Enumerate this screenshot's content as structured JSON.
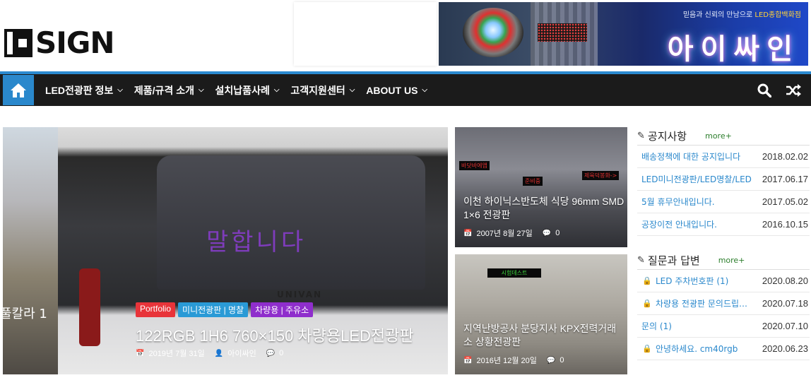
{
  "header": {
    "logo_text": "SIGN",
    "banner": {
      "subtitle_pre": "믿음과 신뢰의 만남으로 ",
      "subtitle_hl": "LED종합백화점",
      "title": "아이싸인",
      "led_sign_text": "LED"
    }
  },
  "nav": {
    "items": [
      {
        "label": "LED전광판 정보"
      },
      {
        "label": "제품/규격 소개"
      },
      {
        "label": "설치납품사례"
      },
      {
        "label": "고객지원센터"
      },
      {
        "label": "ABOUT US"
      }
    ],
    "accent_color": "#2a88cc"
  },
  "main_feature": {
    "prev_slide_text": "풀칼라 1",
    "van_led_text": "말합니다",
    "van_brand": "UNIVAN",
    "tags": [
      {
        "label": "Portfolio",
        "color": "#e8343a"
      },
      {
        "label": "미니전광판 | 명찰",
        "color": "#2a9ad6"
      },
      {
        "label": "차량용 | 주유소",
        "color": "#8f2ecc"
      }
    ],
    "title": "122RGB 1H6 760×150 차량용LED전광판",
    "date": "2019년 7월 31일",
    "author": "아이싸인",
    "comments": "0"
  },
  "side_features": [
    {
      "signs": [
        "바닷바에앱",
        "준비중",
        "제육덕봉화->"
      ],
      "title": "이천 하이닉스반도체 식당 96mm SMD 1×6 전광판",
      "date": "2007년 8월 27일",
      "comments": "0"
    },
    {
      "signs": [
        "시험데스트"
      ],
      "title": "지역난방공사 분당지사 KPX전력거래소 상황전광판",
      "date": "2016년 12월 20일",
      "comments": "0"
    }
  ],
  "sidebar": {
    "notices": {
      "title": "공지사항",
      "more": "more+",
      "items": [
        {
          "title": "배송정책에 대한 공지입니다",
          "date": "2018.02.02"
        },
        {
          "title": "LED미니전광판/LED명찰/LED",
          "date": "2017.06.17"
        },
        {
          "title": "5월 휴무안내입니다.",
          "date": "2017.05.02"
        },
        {
          "title": "공장이전 안내입니다.",
          "date": "2016.10.15"
        }
      ]
    },
    "qna": {
      "title": "질문과 답변",
      "more": "more+",
      "items": [
        {
          "title": "LED 주차번호판 (1)",
          "date": "2020.08.20",
          "locked": true
        },
        {
          "title": "차량용 전광판 문의드립니다",
          "date": "2020.07.18",
          "locked": true
        },
        {
          "title": "문의 (1)",
          "date": "2020.07.10",
          "locked": false
        },
        {
          "title": "안녕하세요. cm40rgb",
          "date": "2020.06.23",
          "locked": true
        }
      ]
    }
  }
}
